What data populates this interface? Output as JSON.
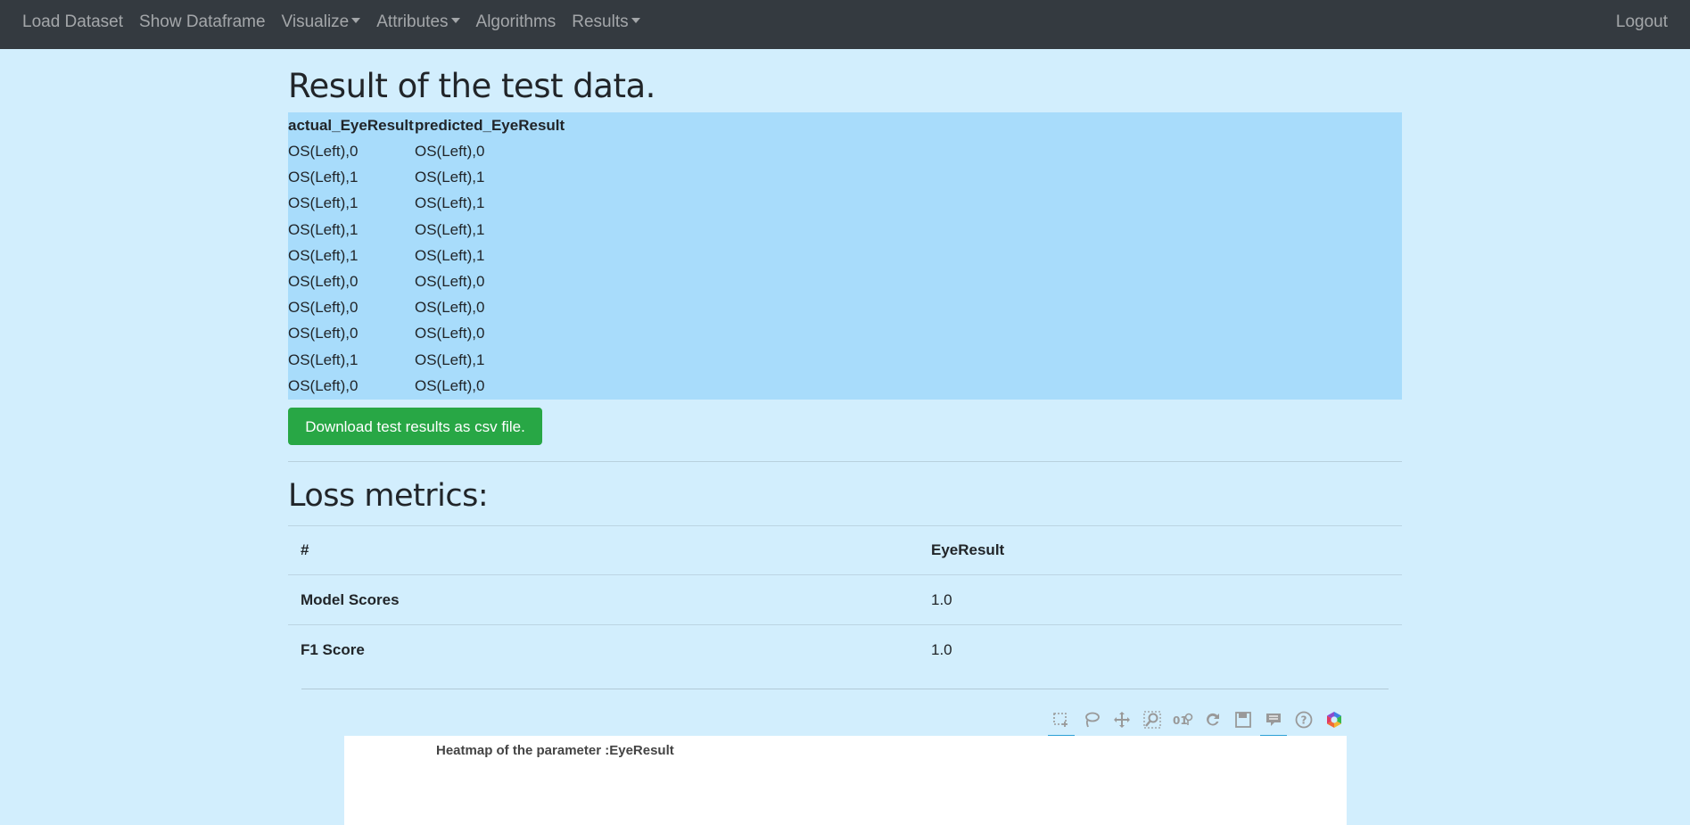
{
  "navbar": {
    "items": [
      {
        "label": "Load Dataset",
        "dropdown": false
      },
      {
        "label": "Show Dataframe",
        "dropdown": false
      },
      {
        "label": "Visualize",
        "dropdown": true
      },
      {
        "label": "Attributes",
        "dropdown": true
      },
      {
        "label": "Algorithms",
        "dropdown": false
      },
      {
        "label": "Results",
        "dropdown": true
      }
    ],
    "logout": "Logout"
  },
  "results": {
    "title": "Result of the test data.",
    "columns": [
      "actual_EyeResult",
      "predicted_EyeResult"
    ],
    "rows": [
      [
        "OS(Left),0",
        "OS(Left),0"
      ],
      [
        "OS(Left),1",
        "OS(Left),1"
      ],
      [
        "OS(Left),1",
        "OS(Left),1"
      ],
      [
        "OS(Left),1",
        "OS(Left),1"
      ],
      [
        "OS(Left),1",
        "OS(Left),1"
      ],
      [
        "OS(Left),0",
        "OS(Left),0"
      ],
      [
        "OS(Left),0",
        "OS(Left),0"
      ],
      [
        "OS(Left),0",
        "OS(Left),0"
      ],
      [
        "OS(Left),1",
        "OS(Left),1"
      ],
      [
        "OS(Left),0",
        "OS(Left),0"
      ]
    ],
    "download_label": "Download test results as csv file."
  },
  "loss": {
    "title": "Loss metrics:",
    "header": [
      "#",
      "EyeResult"
    ],
    "rows": [
      [
        "Model Scores",
        "1.0"
      ],
      [
        "F1 Score",
        "1.0"
      ]
    ]
  },
  "plot": {
    "title": "Heatmap of the parameter :EyeResult",
    "modebar": [
      "box-select-icon",
      "lasso-select-icon",
      "pan-icon",
      "zoom-icon",
      "data-labels-icon",
      "reset-icon",
      "save-icon",
      "hover-icon",
      "help-icon",
      "logo-icon"
    ]
  },
  "colors": {
    "page_bg": "#d2eefd",
    "navbar_bg": "#343a40",
    "table_bg": "#a8dcfb",
    "button_bg": "#28a745"
  }
}
